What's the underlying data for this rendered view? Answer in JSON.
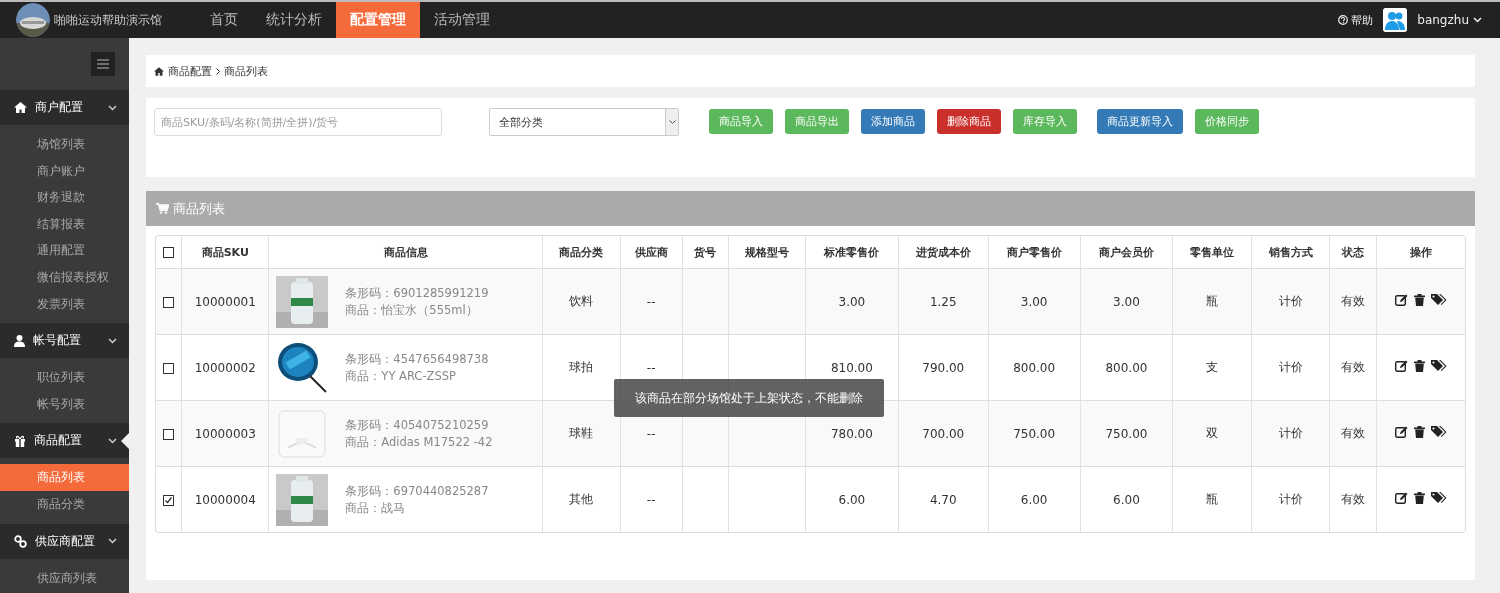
{
  "topbar": {
    "site_title": "啪啪运动帮助演示馆",
    "nav": [
      {
        "label": "首页",
        "selected": false
      },
      {
        "label": "统计分析",
        "selected": false
      },
      {
        "label": "配置管理",
        "selected": true
      },
      {
        "label": "活动管理",
        "selected": false
      }
    ],
    "help": "帮助",
    "user": "bangzhu"
  },
  "sidebar": {
    "groups": [
      {
        "kind": "home",
        "label": "商户配置",
        "expanded": true,
        "active": false,
        "items": [
          {
            "label": "场馆列表",
            "selected": false
          },
          {
            "label": "商户账户",
            "selected": false
          },
          {
            "label": "财务退款",
            "selected": false
          },
          {
            "label": "结算报表",
            "selected": false
          },
          {
            "label": "通用配置",
            "selected": false
          },
          {
            "label": "微信报表授权",
            "selected": false
          },
          {
            "label": "发票列表",
            "selected": false
          }
        ]
      },
      {
        "kind": "user",
        "label": "帐号配置",
        "expanded": true,
        "active": false,
        "items": [
          {
            "label": "职位列表",
            "selected": false
          },
          {
            "label": "帐号列表",
            "selected": false
          }
        ]
      },
      {
        "kind": "gift",
        "label": "商品配置",
        "expanded": true,
        "active": true,
        "items": [
          {
            "label": "商品列表",
            "selected": true
          },
          {
            "label": "商品分类",
            "selected": false
          }
        ]
      },
      {
        "kind": "link",
        "label": "供应商配置",
        "expanded": true,
        "active": false,
        "items": [
          {
            "label": "供应商列表",
            "selected": false
          }
        ]
      }
    ]
  },
  "breadcrumb": [
    "商品配置",
    "商品列表"
  ],
  "toolbar": {
    "search": {
      "placeholder": "商品SKU/条码/名称(简拼/全拼)/货号"
    },
    "category_select": {
      "value": "全部分类"
    },
    "buttons": [
      {
        "label": "商品导入",
        "kind": "success"
      },
      {
        "label": "商品导出",
        "kind": "success"
      },
      {
        "label": "添加商品",
        "kind": "primary"
      },
      {
        "label": "删除商品",
        "kind": "danger"
      },
      {
        "label": "库存导入",
        "kind": "success"
      },
      {
        "label": "商品更新导入",
        "kind": "primary"
      },
      {
        "label": "价格同步",
        "kind": "success"
      }
    ]
  },
  "panel": {
    "title": "商品列表"
  },
  "table": {
    "header_checked": false,
    "columns": [
      "商品SKU",
      "商品信息",
      "商品分类",
      "供应商",
      "货号",
      "规格型号",
      "标准零售价",
      "进货成本价",
      "商户零售价",
      "商户会员价",
      "零售单位",
      "销售方式",
      "状态",
      "操作"
    ],
    "rows": [
      {
        "checked": false,
        "sku": "10000001",
        "barcode": "条形码：6901285991219",
        "name": "商品：怡宝水（555ml）",
        "category": "饮料",
        "supplier": "--",
        "std_price": "3.00",
        "cost": "1.25",
        "retail": "3.00",
        "member": "3.00",
        "unit": "瓶",
        "sale_mode": "计价",
        "status": "有效"
      },
      {
        "checked": false,
        "sku": "10000002",
        "barcode": "条形码：4547656498738",
        "name": "商品：YY ARC-ZSSP",
        "category": "球拍",
        "supplier": "--",
        "std_price": "810.00",
        "cost": "790.00",
        "retail": "800.00",
        "member": "800.00",
        "unit": "支",
        "sale_mode": "计价",
        "status": "有效"
      },
      {
        "checked": false,
        "sku": "10000003",
        "barcode": "条形码：4054075210259",
        "name": "商品：Adidas M17522 -42",
        "category": "球鞋",
        "supplier": "--",
        "std_price": "780.00",
        "cost": "700.00",
        "retail": "750.00",
        "member": "750.00",
        "unit": "双",
        "sale_mode": "计价",
        "status": "有效"
      },
      {
        "checked": true,
        "sku": "10000004",
        "barcode": "条形码：6970440825287",
        "name": "商品：战马",
        "category": "其他",
        "supplier": "--",
        "std_price": "6.00",
        "cost": "4.70",
        "retail": "6.00",
        "member": "6.00",
        "unit": "瓶",
        "sale_mode": "计价",
        "status": "有效"
      }
    ]
  },
  "tooltip": "该商品在部分场馆处于上架状态，不能删除"
}
